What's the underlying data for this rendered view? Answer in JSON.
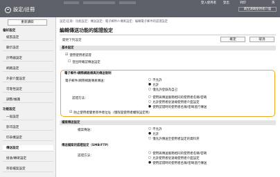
{
  "header": {
    "brand_label": "設定/註冊",
    "top_links": [
      "登入使用者",
      "登出",
      "列印",
      "英"
    ],
    "portal_button": "跳至遠端使用者介面"
  },
  "sidebar": {
    "head_button": "重新讀取",
    "section1": "偏好設定",
    "items1": [
      "紙張設定",
      "顯示設定",
      "計時器設定",
      "網路設定",
      "外部介面設定",
      "可靠性設定",
      "調整/維護"
    ],
    "section2": "功能設定",
    "items2": [
      "一般設定",
      "影印設定",
      "印表機設定",
      "傳送設定",
      "接收/轉寄設定",
      "存取檔案設定"
    ]
  },
  "main": {
    "breadcrumb": "設定/註冊：功能設定：傳送設定：電子郵件/I-傳真設定：編輯電子郵件的認證設定",
    "title": "編輯傳送功能的認證設定",
    "hint": "變更下列設定",
    "ok_label": "確定",
    "cancel_label": "取消",
    "basic": {
      "header": "基本設定",
      "use_auth": "使用使用者認證",
      "use_auth_sub": "登出時確認傳送設定"
    },
    "email": {
      "header": "電子郵件/網際網路傳真的傳送限制",
      "auth_label": "電子郵件/網際網路傳真傳送：",
      "auth_options": [
        "不允許",
        "允許",
        "僅允許登錄為自己"
      ],
      "method_label": "認證方法：",
      "method_options": [
        "使用與傳送服務相同的使用者名稱/密碼",
        "允許使用者從遠端使用者介面設定",
        "使用認證時的使用者名稱/密碼進行傳送"
      ],
      "check_note": "防止使用者變更寄件者位址（僅限當使用者權限設定時）"
    },
    "file": {
      "header": "檔案傳送設定",
      "label": "檔案傳送：",
      "options": [
        "不允許",
        "允許",
        "僅允許傳送至使用者設定的資料夾"
      ]
    },
    "smb": {
      "header": "傳送檔案的認證設定（SMB/FTP）",
      "label": "認證方法：",
      "options": [
        "使用與傳送服務相同的使用者名稱/密碼",
        "允許使用者從遠端使用者介面設定",
        "使用認證時的使用者名稱/密碼進行傳送"
      ]
    }
  },
  "colors": {
    "highlight": "#f0a61b",
    "topbar": "#5d6068"
  }
}
